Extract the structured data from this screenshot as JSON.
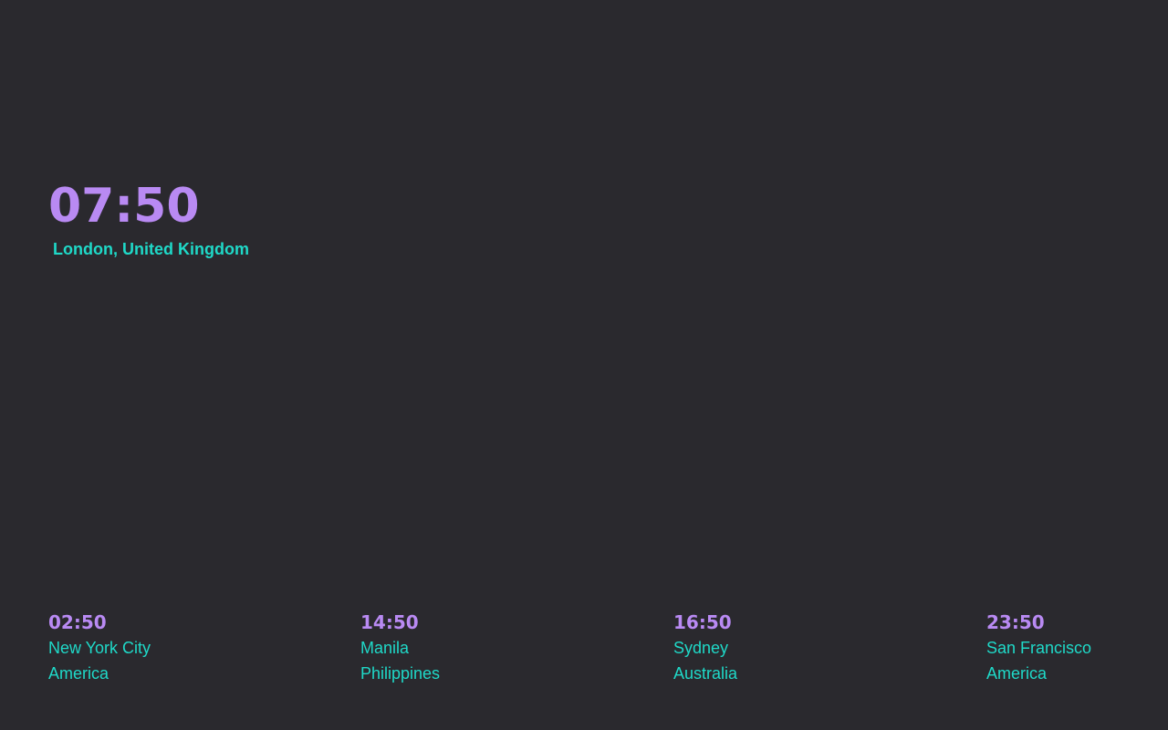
{
  "main": {
    "time": "07:50",
    "location": "London, United Kingdom"
  },
  "cities": [
    {
      "time": "02:50",
      "name": "New York City",
      "region": "America"
    },
    {
      "time": "14:50",
      "name": "Manila",
      "region": "Philippines"
    },
    {
      "time": "16:50",
      "name": "Sydney",
      "region": "Australia"
    },
    {
      "time": "23:50",
      "name": "San Francisco",
      "region": "America"
    }
  ],
  "colors": {
    "background": "#2a292e",
    "time": "#b98af3",
    "location": "#1fd9c8"
  }
}
